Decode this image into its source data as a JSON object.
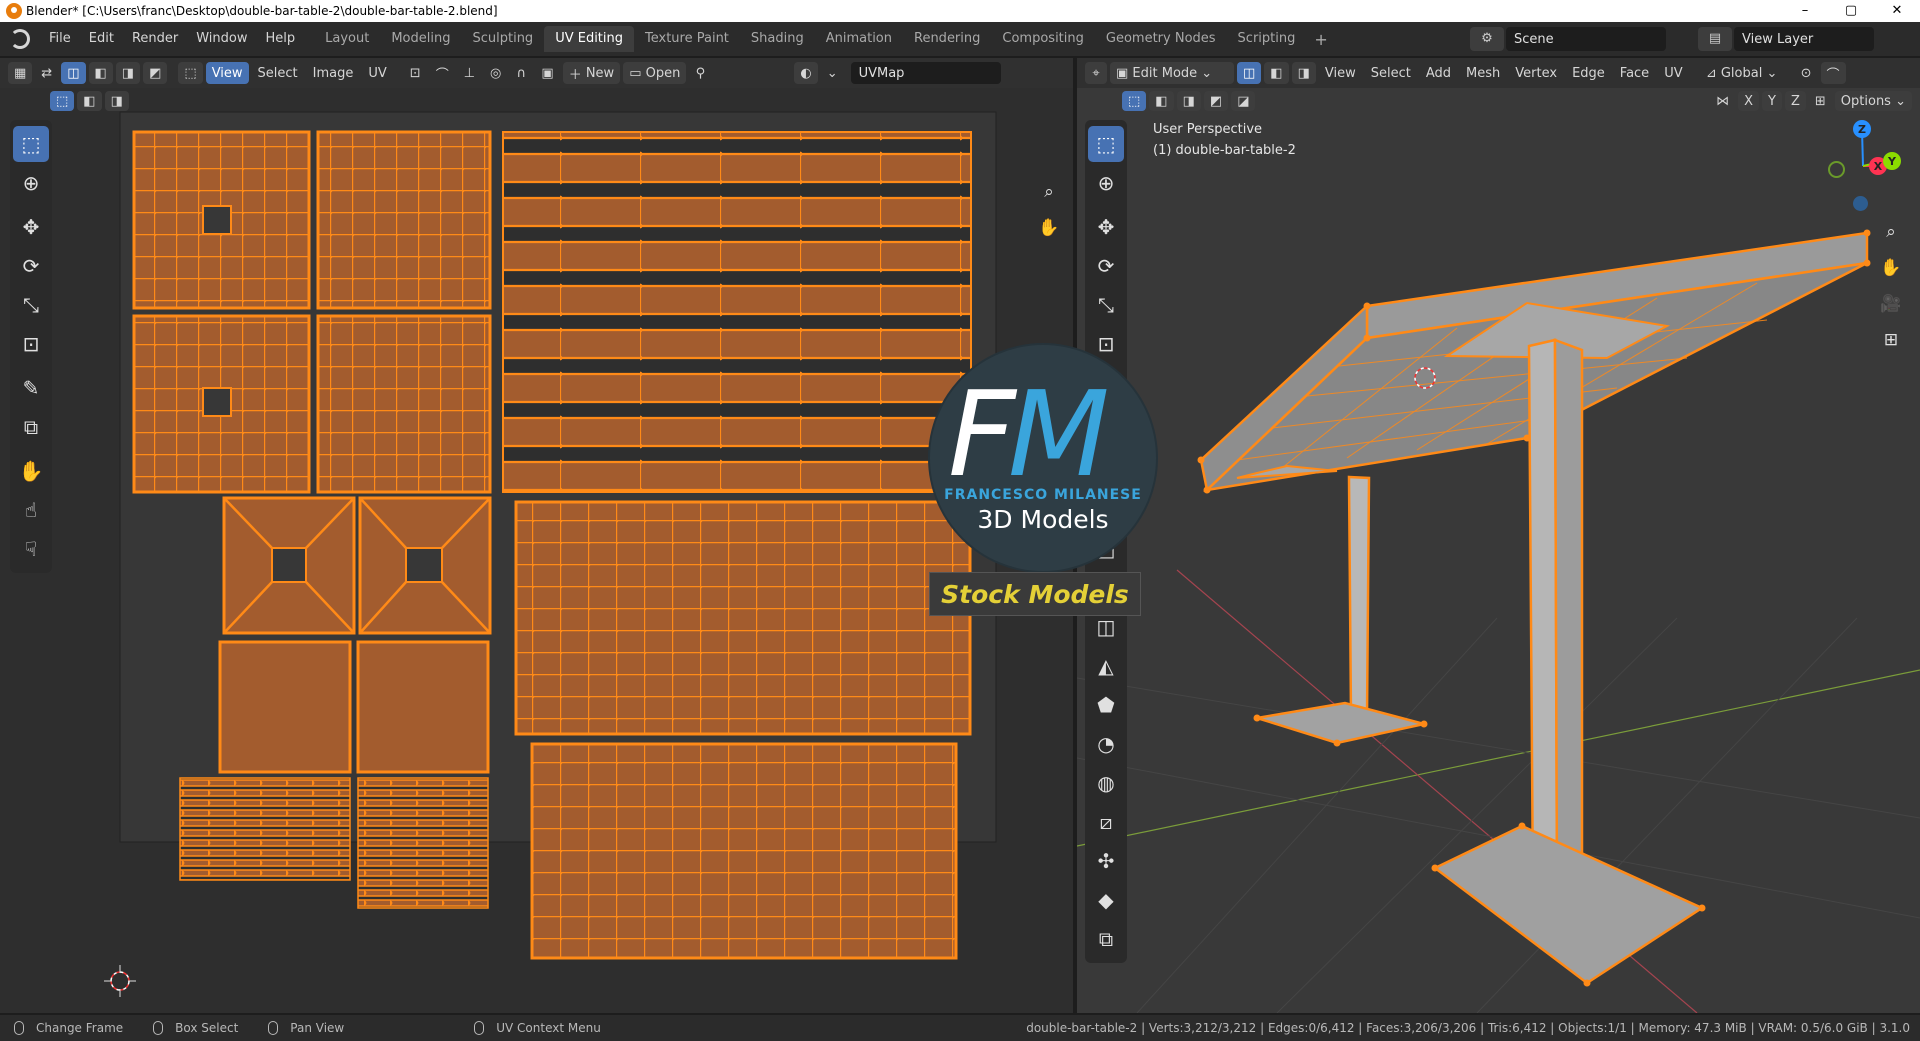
{
  "window": {
    "title": "Blender* [C:\\Users\\franc\\Desktop\\double-bar-table-2\\double-bar-table-2.blend]",
    "controls": [
      "–",
      "▢",
      "✕"
    ]
  },
  "menu": [
    "File",
    "Edit",
    "Render",
    "Window",
    "Help"
  ],
  "workspaces": {
    "tabs": [
      "Layout",
      "Modeling",
      "Sculpting",
      "UV Editing",
      "Texture Paint",
      "Shading",
      "Animation",
      "Rendering",
      "Compositing",
      "Geometry Nodes",
      "Scripting"
    ],
    "active": "UV Editing",
    "add_label": "+"
  },
  "scene": {
    "name": "Scene",
    "view_layer": "View Layer"
  },
  "uv_editor": {
    "header": {
      "view": "View",
      "select": "Select",
      "image": "Image",
      "uv": "UV",
      "new": "New",
      "open": "Open",
      "uvmap": "UVMap"
    }
  },
  "viewport": {
    "mode": "Edit Mode",
    "menus": [
      "View",
      "Select",
      "Add",
      "Mesh",
      "Vertex",
      "Edge",
      "Face",
      "UV"
    ],
    "transform_orientation": "Global",
    "axis_x": "X",
    "axis_y": "Y",
    "axis_z": "Z",
    "options": "Options",
    "perspective": "User Perspective",
    "object": "(1) double-bar-table-2",
    "gizmo": {
      "x": "X",
      "y": "Y",
      "z": "Z"
    }
  },
  "watermark": {
    "letter_f": "F",
    "letter_m": "M",
    "author": "FRANCESCO MILANESE",
    "tagline": "3D Models",
    "stock": "Stock Models"
  },
  "statusbar": {
    "items": [
      "Change Frame",
      "Box Select",
      "Pan View",
      "UV Context Menu"
    ],
    "stats": "double-bar-table-2 | Verts:3,212/3,212 | Edges:0/6,412 | Faces:3,206/3,206 | Tris:6,412 | Objects:1/1 | Memory: 47.3 MiB | VRAM: 0.5/6.0 GiB | 3.1.0"
  },
  "colors": {
    "uv_fill": "#a35c2e",
    "uv_edge": "#ff8a17",
    "active_blue": "#4772b3",
    "axis_x": "#ff3352",
    "axis_y": "#8bdc00",
    "axis_z": "#2890ff"
  }
}
